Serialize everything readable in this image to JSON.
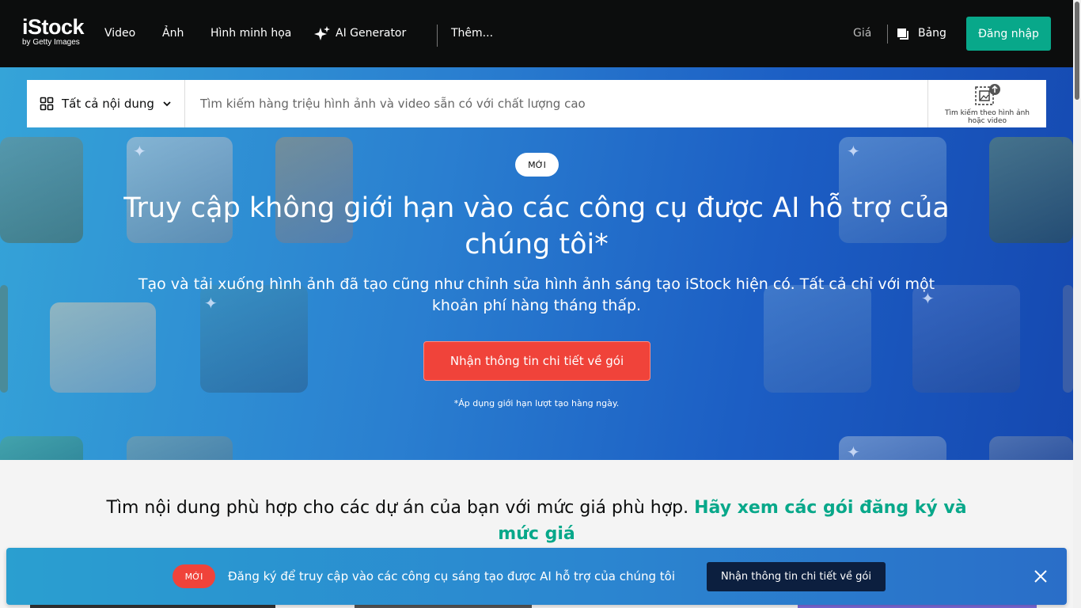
{
  "header": {
    "logo_main": "iStock",
    "logo_sub": "by Getty Images",
    "nav": {
      "video": "Video",
      "photo": "Ảnh",
      "illustration": "Hình minh họa",
      "ai_generator": "AI Generator",
      "more": "Thêm..."
    },
    "price": "Giá",
    "board": "Bảng",
    "login": "Đăng nhập"
  },
  "search": {
    "filter_label": "Tất cả nội dung",
    "placeholder": "Tìm kiếm hàng triệu hình ảnh và video sẵn có với chất lượng cao",
    "visual_search_label": "Tìm kiếm theo hình ảnh hoặc video"
  },
  "hero": {
    "badge": "MỚI",
    "title": "Truy cập không giới hạn vào các công cụ được AI hỗ trợ của chúng tôi*",
    "subtitle": "Tạo và tải xuống hình ảnh đã tạo cũng như chỉnh sửa hình ảnh sáng tạo iStock hiện có. Tất cả chỉ với một khoản phí hàng tháng thấp.",
    "cta": "Nhận thông tin chi tiết về gói",
    "note": "*Áp dụng giới hạn lượt tạo hàng ngày."
  },
  "promo": {
    "text": "Tìm nội dung phù hợp cho các dự án của bạn với mức giá phù hợp.",
    "link": "Hãy xem các gói đăng ký và mức giá"
  },
  "banner": {
    "badge": "MỚI",
    "text": "Đăng ký để truy cập vào các công cụ sáng tạo được AI hỗ trợ của chúng tôi",
    "button": "Nhận thông tin chi tiết về gói"
  },
  "colors": {
    "brand_green": "#08a88a",
    "cta_red": "#f0433a",
    "header_bg": "#0c0d0d",
    "banner_button": "#0c1f3f"
  }
}
